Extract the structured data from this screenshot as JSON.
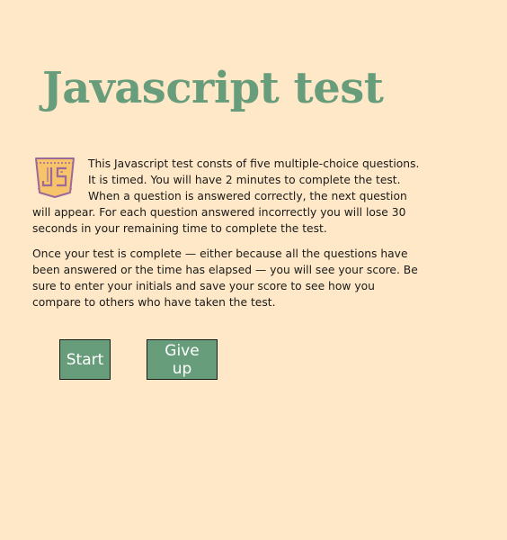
{
  "page": {
    "title": "Javascript test"
  },
  "intro": {
    "logo_icon": "javascript-shield-icon",
    "paragraph_1": "This Javascript test consts of five multiple-choice questions. It is timed. You will have 2 minutes to complete the test. When a question is answered correctly, the next question will appear. For each question answered incorrectly you will lose 30 seconds in your remaining time to complete the test.",
    "paragraph_2": "Once your test is complete — either because all the questions have been answered or the time has elapsed — you will see your score. Be sure to enter your initials and save your score to see how you compare to others who have taken the test."
  },
  "buttons": {
    "start_label": "Start",
    "give_up_label": "Give up"
  },
  "colors": {
    "background": "#ffe8c7",
    "accent": "#679d7b",
    "logo_fill": "#f7c46c",
    "logo_stroke": "#9b6a9b"
  }
}
